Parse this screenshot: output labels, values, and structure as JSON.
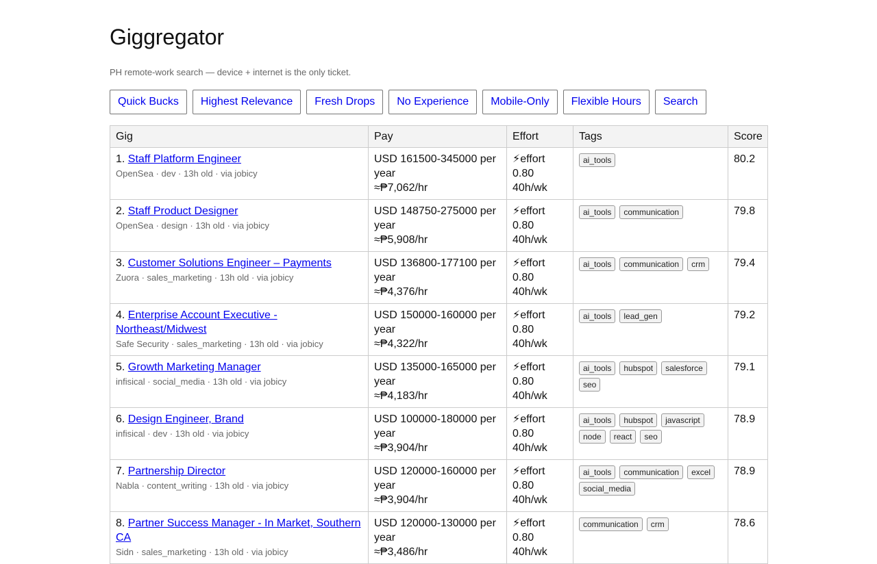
{
  "header": {
    "title": "Giggregator",
    "subtitle": "PH remote-work search — device + internet is the only ticket."
  },
  "toolbar": {
    "buttons": [
      "Quick Bucks",
      "Highest Relevance",
      "Fresh Drops",
      "No Experience",
      "Mobile-Only",
      "Flexible Hours",
      "Search"
    ]
  },
  "table": {
    "headers": {
      "gig": "Gig",
      "pay": "Pay",
      "effort": "Effort",
      "tags": "Tags",
      "score": "Score"
    },
    "rows": [
      {
        "num": "1.",
        "title": "Staff Platform Engineer",
        "meta": "OpenSea · dev · 13h old · via jobicy",
        "pay_line1": "USD 161500-345000 per year",
        "pay_line2": "≈₱7,062/hr",
        "effort": "⚡effort 0.80",
        "hours": "40h/wk",
        "tags": [
          "ai_tools"
        ],
        "score": "80.2"
      },
      {
        "num": "2.",
        "title": "Staff Product Designer",
        "meta": "OpenSea · design · 13h old · via jobicy",
        "pay_line1": "USD 148750-275000 per year",
        "pay_line2": "≈₱5,908/hr",
        "effort": "⚡effort 0.80",
        "hours": "40h/wk",
        "tags": [
          "ai_tools",
          "communication"
        ],
        "score": "79.8"
      },
      {
        "num": "3.",
        "title": "Customer Solutions Engineer – Payments",
        "meta": "Zuora · sales_marketing · 13h old · via jobicy",
        "pay_line1": "USD 136800-177100 per year",
        "pay_line2": "≈₱4,376/hr",
        "effort": "⚡effort 0.80",
        "hours": "40h/wk",
        "tags": [
          "ai_tools",
          "communication",
          "crm"
        ],
        "score": "79.4"
      },
      {
        "num": "4.",
        "title": "Enterprise Account Executive - Northeast/Midwest",
        "meta": "Safe Security · sales_marketing · 13h old · via jobicy",
        "pay_line1": "USD 150000-160000 per year",
        "pay_line2": "≈₱4,322/hr",
        "effort": "⚡effort 0.80",
        "hours": "40h/wk",
        "tags": [
          "ai_tools",
          "lead_gen"
        ],
        "score": "79.2"
      },
      {
        "num": "5.",
        "title": "Growth Marketing Manager",
        "meta": "infisical · social_media · 13h old · via jobicy",
        "pay_line1": "USD 135000-165000 per year",
        "pay_line2": "≈₱4,183/hr",
        "effort": "⚡effort 0.80",
        "hours": "40h/wk",
        "tags": [
          "ai_tools",
          "hubspot",
          "salesforce",
          "seo"
        ],
        "score": "79.1"
      },
      {
        "num": "6.",
        "title": "Design Engineer, Brand",
        "meta": "infisical · dev · 13h old · via jobicy",
        "pay_line1": "USD 100000-180000 per year",
        "pay_line2": "≈₱3,904/hr",
        "effort": "⚡effort 0.80",
        "hours": "40h/wk",
        "tags": [
          "ai_tools",
          "hubspot",
          "javascript",
          "node",
          "react",
          "seo"
        ],
        "score": "78.9"
      },
      {
        "num": "7.",
        "title": "Partnership Director",
        "meta": "Nabla · content_writing · 13h old · via jobicy",
        "pay_line1": "USD 120000-160000 per year",
        "pay_line2": "≈₱3,904/hr",
        "effort": "⚡effort 0.80",
        "hours": "40h/wk",
        "tags": [
          "ai_tools",
          "communication",
          "excel",
          "social_media"
        ],
        "score": "78.9"
      },
      {
        "num": "8.",
        "title": "Partner Success Manager - In Market, Southern CA",
        "meta": "Sidn · sales_marketing · 13h old · via jobicy",
        "pay_line1": "USD 120000-130000 per year",
        "pay_line2": "≈₱3,486/hr",
        "effort": "⚡effort 0.80",
        "hours": "40h/wk",
        "tags": [
          "communication",
          "crm"
        ],
        "score": "78.6"
      }
    ]
  }
}
